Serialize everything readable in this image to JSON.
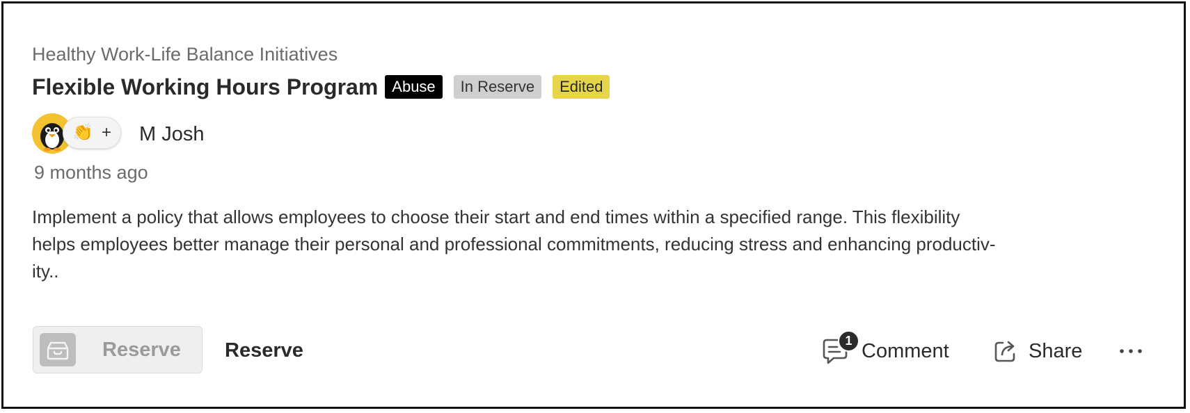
{
  "post": {
    "category": "Healthy Work-Life Balance Initiatives",
    "title": "Flexible Working Hours Program",
    "badges": {
      "abuse": "Abuse",
      "in_reserve": "In Reserve",
      "edited": "Edited"
    },
    "author": {
      "name": "M Josh",
      "avatar_icon": "penguin-icon"
    },
    "reaction": {
      "emoji": "👏",
      "add_label": "+"
    },
    "timestamp": "9 months ago",
    "description_lines": [
      "Implement a policy that allows employees to choose their start and end times within a specified range. This flexibility",
      "helps employees better manage their personal and professional commitments, reducing stress and enhancing productiv-",
      "ity.."
    ]
  },
  "actions": {
    "reserve_button_label": "Reserve",
    "reserve_text": "Reserve",
    "comment_count": "1",
    "comment_label": "Comment",
    "share_label": "Share",
    "more_icon": "more-horizontal-icon"
  },
  "colors": {
    "abuse_badge": "#000000",
    "reserve_badge": "#cfcfcf",
    "edited_badge": "#e6d449",
    "avatar_bg": "#f3c230"
  }
}
